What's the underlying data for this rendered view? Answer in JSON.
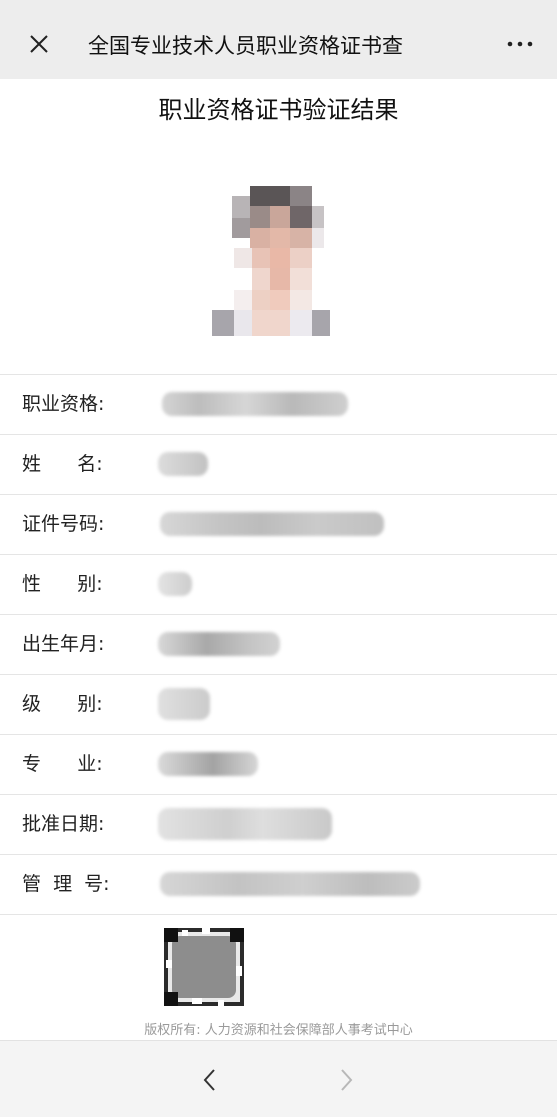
{
  "topbar": {
    "title": "全国专业技术人员职业资格证书查",
    "close_icon": "close-icon",
    "more_icon": "more-icon"
  },
  "headline": "职业资格证书验证结果",
  "fields": [
    {
      "label": "职业资格:"
    },
    {
      "label": "姓      名:"
    },
    {
      "label": "证件号码:"
    },
    {
      "label": "性      别:"
    },
    {
      "label": "出生年月:"
    },
    {
      "label": "级      别:"
    },
    {
      "label": "专      业:"
    },
    {
      "label": "批准日期:"
    },
    {
      "label": "管  理  号:"
    }
  ],
  "copyright": "版权所有: 人力资源和社会保障部人事考试中心",
  "bottombar": {
    "back_icon": "chevron-left-icon",
    "forward_icon": "chevron-right-icon"
  },
  "colors": {
    "topbar_bg": "#ededed",
    "bottombar_bg": "#f4f4f4",
    "divider": "#e5e5e5",
    "blur_gray": "#cfcfcf"
  }
}
